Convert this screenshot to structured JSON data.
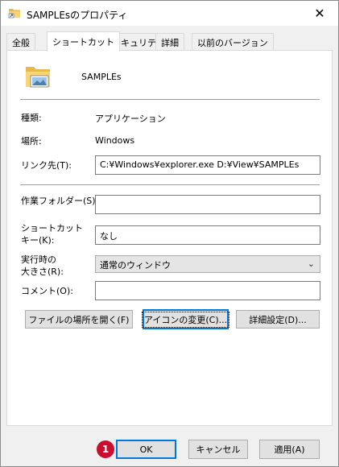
{
  "window": {
    "title": "SAMPLEsのプロパティ",
    "close_glyph": "✕"
  },
  "tabs": [
    {
      "label": "全般"
    },
    {
      "label": "ショートカット",
      "active": true
    },
    {
      "label": "セキュリティ"
    },
    {
      "label": "詳細"
    },
    {
      "label": "以前のバージョン"
    }
  ],
  "shortcut": {
    "name": "SAMPLEs",
    "type_label": "種類:",
    "type_value": "アプリケーション",
    "location_label": "場所:",
    "location_value": "Windows",
    "target_label": "リンク先(T):",
    "target_value": "C:¥Windows¥explorer.exe D:¥View¥SAMPLEs",
    "startin_label": "作業フォルダー(S):",
    "startin_value": "",
    "hotkey_label_1": "ショートカット",
    "hotkey_label_2": "キー(K):",
    "hotkey_value": "なし",
    "run_label_1": "実行時の",
    "run_label_2": "大きさ(R):",
    "run_value": "通常のウィンドウ",
    "comment_label": "コメント(O):",
    "comment_value": ""
  },
  "actions": {
    "open_location": "ファイルの場所を開く(F)",
    "change_icon": "アイコンの変更(C)...",
    "advanced": "詳細設定(D)..."
  },
  "footer": {
    "ok": "OK",
    "cancel": "キャンセル",
    "apply": "適用(A)"
  },
  "annotation": {
    "badge_number": "1",
    "badge_color": "#c8102e"
  },
  "colors": {
    "accent": "#0078d7",
    "button_bg": "#e1e1e1",
    "window_bg": "#f0f0f0"
  }
}
